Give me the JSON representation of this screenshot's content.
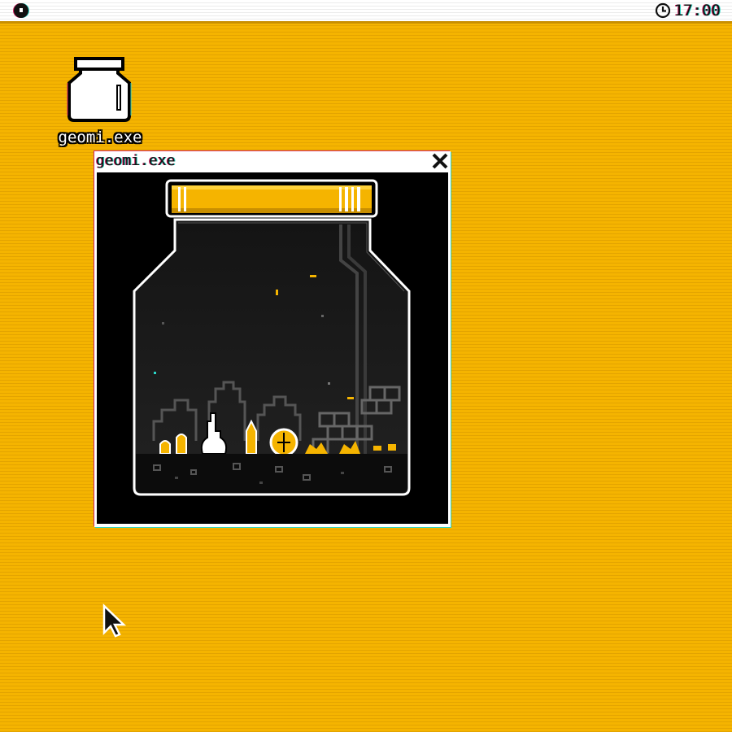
{
  "menubar": {
    "menu_icon": "apple-menu-dot-icon",
    "clock_icon": "clock-icon",
    "time": "17:00"
  },
  "desktop": {
    "icon": {
      "name": "jar-icon",
      "label": "geomi.exe"
    }
  },
  "window": {
    "title": "geomi.exe",
    "close_icon": "close-x-icon",
    "content": "terrarium-jar-illustration"
  },
  "cursor": {
    "icon": "arrow-pointer-icon"
  },
  "colors": {
    "desktop": "#f5b400",
    "menubar": "#ffffff",
    "jar_lid": "#f5b400",
    "glow": "#ffd23a",
    "window_bg": "#000000"
  }
}
